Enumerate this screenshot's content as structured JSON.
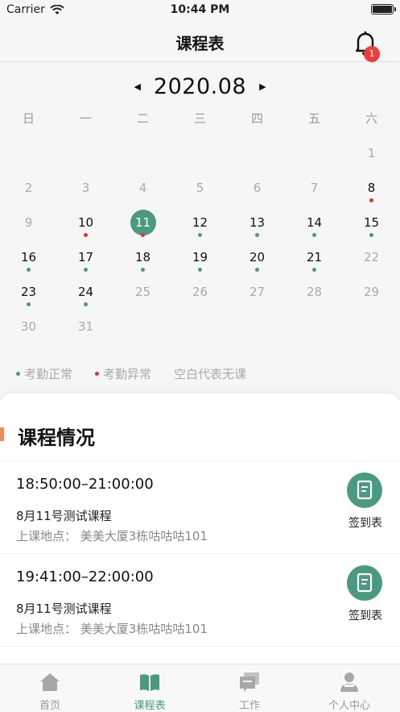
{
  "status_bar": {
    "carrier": "Carrier",
    "time": "10:44 PM"
  },
  "nav": {
    "title": "课程表",
    "notification_count": "1",
    "bell_icon": "bell-icon"
  },
  "calendar": {
    "month": "2020.08",
    "weekdays": [
      "日",
      "一",
      "二",
      "三",
      "四",
      "五",
      "六"
    ],
    "weeks": [
      [
        null,
        null,
        null,
        null,
        null,
        null,
        {
          "d": "1",
          "s": "muted"
        }
      ],
      [
        {
          "d": "2",
          "s": "muted"
        },
        {
          "d": "3",
          "s": "muted"
        },
        {
          "d": "4",
          "s": "muted"
        },
        {
          "d": "5",
          "s": "muted"
        },
        {
          "d": "6",
          "s": "muted"
        },
        {
          "d": "7",
          "s": "muted"
        },
        {
          "d": "8",
          "s": "active",
          "dot": "abnormal"
        }
      ],
      [
        {
          "d": "9",
          "s": "muted"
        },
        {
          "d": "10",
          "s": "active",
          "dot": "abnormal"
        },
        {
          "d": "11",
          "s": "selected",
          "dot": "abnormal"
        },
        {
          "d": "12",
          "s": "active",
          "dot": "normal"
        },
        {
          "d": "13",
          "s": "active",
          "dot": "normal"
        },
        {
          "d": "14",
          "s": "active",
          "dot": "normal"
        },
        {
          "d": "15",
          "s": "active",
          "dot": "normal"
        }
      ],
      [
        {
          "d": "16",
          "s": "active",
          "dot": "normal"
        },
        {
          "d": "17",
          "s": "active",
          "dot": "normal"
        },
        {
          "d": "18",
          "s": "active",
          "dot": "normal"
        },
        {
          "d": "19",
          "s": "active",
          "dot": "normal"
        },
        {
          "d": "20",
          "s": "active",
          "dot": "normal"
        },
        {
          "d": "21",
          "s": "active",
          "dot": "normal"
        },
        {
          "d": "22",
          "s": "muted"
        }
      ],
      [
        {
          "d": "23",
          "s": "active",
          "dot": "normal"
        },
        {
          "d": "24",
          "s": "active",
          "dot": "normal"
        },
        {
          "d": "25",
          "s": "muted"
        },
        {
          "d": "26",
          "s": "muted"
        },
        {
          "d": "27",
          "s": "muted"
        },
        {
          "d": "28",
          "s": "muted"
        },
        {
          "d": "29",
          "s": "muted"
        }
      ],
      [
        {
          "d": "30",
          "s": "muted"
        },
        {
          "d": "31",
          "s": "muted"
        },
        null,
        null,
        null,
        null,
        null
      ]
    ]
  },
  "legend": {
    "normal": "考勤正常",
    "abnormal": "考勤异常",
    "blank": "空白代表无课"
  },
  "colors": {
    "accent": "#4a9a80",
    "normal_dot": "#4a9a80",
    "abnormal_dot": "#e0352b",
    "section_bar": "#f08a5d"
  },
  "courses_section": {
    "title": "课程情况",
    "items": [
      {
        "time": "18:50:00–21:00:00",
        "name": "8月11号测试课程",
        "location": "上课地点：  美美大厦3栋咕咕咕101",
        "action": "签到表"
      },
      {
        "time": "19:41:00–22:00:00",
        "name": "8月11号测试课程",
        "location": "上课地点：  美美大厦3栋咕咕咕101",
        "action": "签到表"
      }
    ]
  },
  "tabs": [
    {
      "label": "首页",
      "icon": "home-icon",
      "active": false
    },
    {
      "label": "课程表",
      "icon": "book-icon",
      "active": true
    },
    {
      "label": "工作",
      "icon": "work-icon",
      "active": false
    },
    {
      "label": "个人中心",
      "icon": "user-icon",
      "active": false
    }
  ]
}
